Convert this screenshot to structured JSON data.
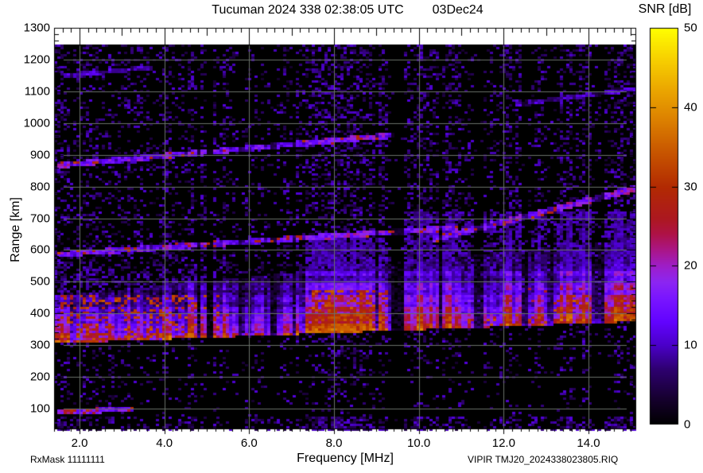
{
  "header": {
    "title": "Tucuman 2024 338 02:38:05 UTC",
    "date": "03Dec24"
  },
  "colorbar": {
    "title": "SNR [dB]",
    "ticks": [
      {
        "v": 0,
        "label": "0"
      },
      {
        "v": 10,
        "label": "10"
      },
      {
        "v": 20,
        "label": "20"
      },
      {
        "v": 30,
        "label": "30"
      },
      {
        "v": 40,
        "label": "40"
      },
      {
        "v": 50,
        "label": "50"
      }
    ]
  },
  "footer": {
    "left": "RxMask 11111111",
    "right": "VIPIR  TMJ20_2024338023805.RIQ"
  },
  "chart_data": {
    "type": "heatmap",
    "description": "Ionosonde SNR spectrogram: SNR [dB] vs frequency [MHz] and virtual range [km]",
    "x": {
      "label": "Frequency [MHz]",
      "min": 1.4,
      "max": 15.125,
      "minor_step": 0.2,
      "mid_step": 1.0,
      "ticks": [
        {
          "v": 2,
          "label": "2.0"
        },
        {
          "v": 4,
          "label": "4.0"
        },
        {
          "v": 6,
          "label": "6.0"
        },
        {
          "v": 8,
          "label": "8.0"
        },
        {
          "v": 10,
          "label": "10.0"
        },
        {
          "v": 12,
          "label": "12.0"
        },
        {
          "v": 14,
          "label": "14.0"
        }
      ]
    },
    "y": {
      "label": "Range [km]",
      "min": 35,
      "max": 1300,
      "minor_step": 20,
      "ticks": [
        {
          "v": 100,
          "label": "100"
        },
        {
          "v": 200,
          "label": "200"
        },
        {
          "v": 300,
          "label": "300"
        },
        {
          "v": 400,
          "label": "400"
        },
        {
          "v": 500,
          "label": "500"
        },
        {
          "v": 600,
          "label": "600"
        },
        {
          "v": 700,
          "label": "700"
        },
        {
          "v": 800,
          "label": "800"
        },
        {
          "v": 900,
          "label": "900"
        },
        {
          "v": 1000,
          "label": "1000"
        },
        {
          "v": 1100,
          "label": "1100"
        },
        {
          "v": 1200,
          "label": "1200"
        },
        {
          "v": 1300,
          "label": "1300"
        }
      ]
    },
    "z": {
      "label": "SNR [dB]",
      "min": 0,
      "max": 50
    },
    "data_top_km": 1245,
    "grid_color": "#6a706a",
    "plot_background": "#000000",
    "page_background": "#ffffff",
    "colormap_stops": [
      [
        0,
        "#000000"
      ],
      [
        3,
        "#14002a"
      ],
      [
        7,
        "#2e0070"
      ],
      [
        10,
        "#4a00c8"
      ],
      [
        13,
        "#6203ff"
      ],
      [
        16,
        "#7a16ff"
      ],
      [
        18,
        "#8c26f2"
      ],
      [
        20,
        "#9e1ec8"
      ],
      [
        22,
        "#aa1688"
      ],
      [
        24,
        "#ae1248"
      ],
      [
        26,
        "#ac1820"
      ],
      [
        30,
        "#b22a02"
      ],
      [
        34,
        "#c65200"
      ],
      [
        38,
        "#da7c00"
      ],
      [
        42,
        "#eaa400"
      ],
      [
        46,
        "#f7cf00"
      ],
      [
        50,
        "#ffff00"
      ]
    ],
    "features": {
      "band": {
        "h0_base_km": 306,
        "h0_slope_km_per_MHz": 5.0,
        "f_ref_MHz": 1.5,
        "thickness_base_km": 150,
        "thickness_slope_km_per_MHz": 8,
        "edge_snr_db": 27,
        "peak_snr_db": 19
      },
      "strata_rows_km": [
        332,
        358,
        386,
        412,
        448,
        486,
        525
      ],
      "region_gains": [
        [
          1.4,
          2.5,
          1.1
        ],
        [
          2.5,
          5.2,
          1.0
        ],
        [
          5.2,
          7.3,
          0.8
        ],
        [
          7.3,
          9.25,
          1.25
        ],
        [
          9.25,
          9.7,
          0.9
        ],
        [
          9.7,
          11.0,
          1.05
        ],
        [
          11.0,
          13.0,
          0.95
        ],
        [
          13.0,
          15.2,
          1.1
        ]
      ],
      "bright_stripes": [
        [
          1.4,
          1.72,
          1.8
        ],
        [
          2.05,
          2.18,
          1.35
        ],
        [
          2.33,
          2.4,
          1.3
        ],
        [
          3.1,
          3.18,
          1.25
        ],
        [
          3.95,
          4.08,
          1.5
        ],
        [
          4.55,
          4.72,
          2.0
        ],
        [
          4.9,
          5.0,
          1.3
        ],
        [
          5.3,
          5.42,
          1.6
        ],
        [
          6.1,
          6.22,
          1.3
        ],
        [
          7.35,
          7.52,
          1.5
        ],
        [
          7.55,
          8.55,
          2.1
        ],
        [
          8.6,
          9.2,
          1.5
        ],
        [
          9.8,
          10.4,
          1.5
        ],
        [
          10.6,
          11.25,
          1.25
        ],
        [
          12.0,
          12.3,
          1.45
        ],
        [
          12.7,
          12.95,
          1.2
        ],
        [
          13.3,
          14.0,
          1.5
        ],
        [
          14.45,
          15.12,
          1.7
        ]
      ],
      "rfi_notches": [
        [
          4.78,
          4.86,
          0.25
        ],
        [
          5.02,
          5.14,
          0.05
        ],
        [
          5.78,
          5.88,
          0.3
        ],
        [
          6.5,
          6.64,
          0.15
        ],
        [
          7.06,
          7.12,
          0.3
        ],
        [
          8.98,
          9.06,
          0.3
        ],
        [
          9.32,
          9.68,
          0.06
        ],
        [
          10.45,
          10.56,
          0.2
        ],
        [
          11.32,
          11.5,
          0.12
        ],
        [
          12.45,
          12.58,
          0.15
        ],
        [
          13.05,
          13.16,
          0.2
        ],
        [
          14.05,
          14.38,
          0.25
        ]
      ],
      "hot_zones": [
        [
          1.5,
          5.3,
          312,
          455,
          0.22
        ],
        [
          7.45,
          9.25,
          330,
          475,
          0.45
        ],
        [
          10.2,
          15.12,
          348,
          400,
          0.18
        ],
        [
          13.2,
          15.12,
          378,
          462,
          0.22
        ]
      ],
      "haze_patches": [
        [
          9.6,
          15.12,
          390,
          720,
          0.45,
          6
        ],
        [
          7.3,
          9.3,
          460,
          640,
          0.4,
          6
        ],
        [
          1.4,
          5.2,
          455,
          540,
          0.25,
          5
        ]
      ],
      "oblique_traces": [
        {
          "f0": 1.5,
          "f1": 9.45,
          "r0": 866,
          "r1": 962,
          "halfwidth_km": 9,
          "snr_db": 14,
          "hot_p": 0.07
        },
        {
          "f0": 1.5,
          "f1": 10.9,
          "r0": 586,
          "r1": 670,
          "halfwidth_km": 9,
          "snr_db": 14,
          "hot_p": 0.1
        },
        {
          "f0": 10.35,
          "f1": 15.12,
          "r0": 634,
          "r1": 792,
          "halfwidth_km": 10,
          "snr_db": 15,
          "hot_p": 0.09
        },
        {
          "f0": 12.3,
          "f1": 15.12,
          "r0": 1060,
          "r1": 1106,
          "halfwidth_km": 7,
          "snr_db": 9,
          "hot_p": 0
        },
        {
          "f0": 1.6,
          "f1": 3.7,
          "r0": 1148,
          "r1": 1175,
          "halfwidth_km": 7,
          "snr_db": 9,
          "hot_p": 0
        },
        {
          "f0": 1.45,
          "f1": 3.3,
          "r0": 88,
          "r1": 99,
          "halfwidth_km": 8,
          "snr_db": 16,
          "hot_p": 0.12
        }
      ],
      "noise": {
        "base_p": 0.3,
        "upper_fade_p": 0.7,
        "speckle_db_min": 3,
        "speckle_db_max": 11,
        "bottom_row_km": 75
      }
    }
  }
}
